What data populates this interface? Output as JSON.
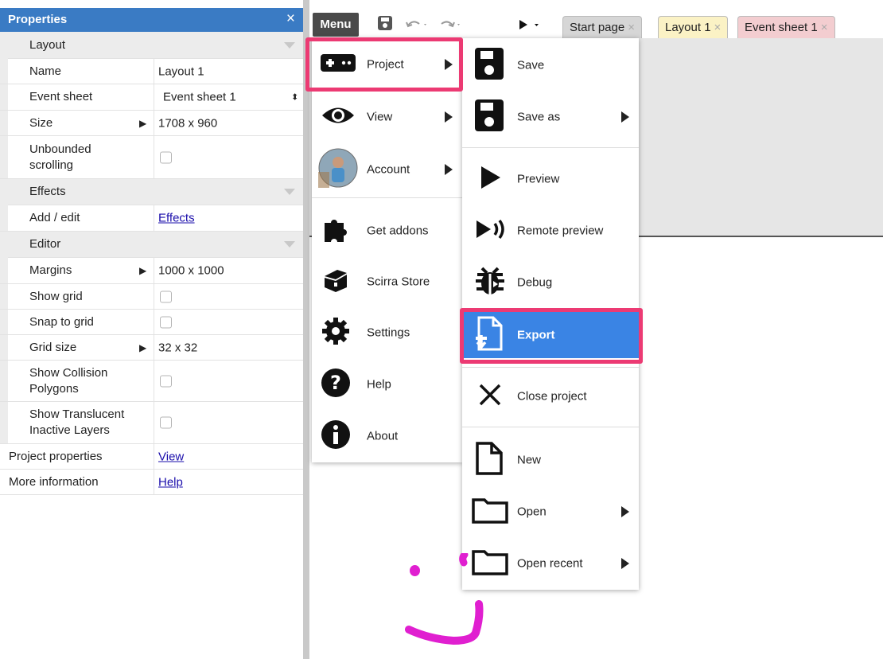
{
  "properties": {
    "title": "Properties",
    "close_glyph": "×",
    "sections": {
      "layout": "Layout",
      "effects": "Effects",
      "editor": "Editor"
    },
    "rows": {
      "name_label": "Name",
      "name_value": "Layout 1",
      "event_sheet_label": "Event sheet",
      "event_sheet_value": "Event sheet 1",
      "size_label": "Size",
      "size_value": "1708 x 960",
      "unbounded_label_1": "Unbounded",
      "unbounded_label_2": "scrolling",
      "add_edit_label": "Add / edit",
      "add_edit_link": "Effects",
      "margins_label": "Margins",
      "margins_value": "1000 x 1000",
      "show_grid_label": "Show grid",
      "snap_label": "Snap to grid",
      "grid_size_label": "Grid size",
      "grid_size_value": "32 x 32",
      "collision_label_1": "Show Collision",
      "collision_label_2": "Polygons",
      "translucent_label_1": "Show Translucent",
      "translucent_label_2": "Inactive Layers",
      "project_props_label": "Project properties",
      "project_props_link": "View",
      "more_info_label": "More information",
      "more_info_link": "Help"
    }
  },
  "toolbar": {
    "menu_label": "Menu",
    "tabs": [
      "Start page",
      "Layout 1",
      "Event sheet 1"
    ],
    "tab_close": "×"
  },
  "main_menu": {
    "items": [
      "Project",
      "View",
      "Account",
      "Get addons",
      "Scirra Store",
      "Settings",
      "Help",
      "About"
    ]
  },
  "project_submenu": {
    "items": [
      "Save",
      "Save as",
      "Preview",
      "Remote preview",
      "Debug",
      "Export",
      "Close project",
      "New",
      "Open",
      "Open recent"
    ]
  },
  "colors": {
    "header_blue": "#3a7bc4",
    "highlight_pink": "#ec3a73",
    "active_blue": "#3a84e4",
    "annotation_magenta": "#e01fd0"
  }
}
